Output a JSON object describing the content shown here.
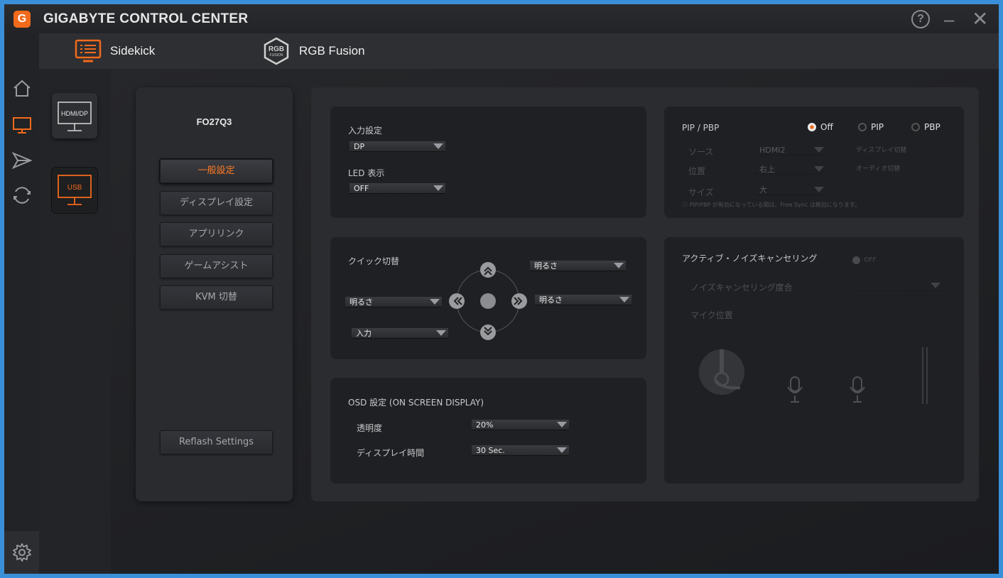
{
  "app": {
    "logo_letter": "G",
    "title": "GIGABYTE CONTROL CENTER"
  },
  "window_controls": {
    "help": "?",
    "minimize": "–",
    "close": "✕"
  },
  "tabs": [
    {
      "label": "Sidekick",
      "icon": "sidekick-icon"
    },
    {
      "label": "RGB Fusion",
      "icon": "rgb-fusion-icon",
      "icon_text_top": "RGB",
      "icon_text_bottom": "FUSION"
    }
  ],
  "devices": [
    {
      "label": "HDMI/DP"
    },
    {
      "label": "USB",
      "selected": true
    }
  ],
  "model": {
    "name": "FO27Q3"
  },
  "menu": [
    {
      "label": "一般設定",
      "active": true
    },
    {
      "label": "ディスプレイ設定"
    },
    {
      "label": "アプリリンク"
    },
    {
      "label": "ゲームアシスト"
    },
    {
      "label": "KVM 切替"
    }
  ],
  "reflash_label": "Reflash Settings",
  "input_card": {
    "input_label": "入力設定",
    "input_value": "DP",
    "led_label": "LED 表示",
    "led_value": "OFF"
  },
  "quick_card": {
    "title": "クイック切替",
    "up": "明るさ",
    "left": "明るさ",
    "right": "明るさ",
    "down": "入力"
  },
  "osd_card": {
    "title": "OSD 設定 (ON SCREEN DISPLAY)",
    "transparency_label": "透明度",
    "transparency_value": "20%",
    "display_time_label": "ディスプレイ時間",
    "display_time_value": "30 Sec."
  },
  "pip_card": {
    "title": "PIP / PBP",
    "options": [
      "Off",
      "PIP",
      "PBP"
    ],
    "selected": "Off",
    "source_label": "ソース",
    "source_value": "HDMI2",
    "position_label": "位置",
    "position_value": "右上",
    "size_label": "サイズ",
    "size_value": "大",
    "btn1": "ディスプレイ切替",
    "btn2": "オーディオ切替",
    "note": "ⓘ PIP/PBP が有効になっている間は、Free Sync は無効になります。"
  },
  "anc_card": {
    "title": "アクティブ・ノイズキャンセリング",
    "toggle": "OFF",
    "level_label": "ノイズキャンセリング度合",
    "mic_label": "マイク位置"
  },
  "colors": {
    "accent": "#f26a1b",
    "bg": "#1c1d20"
  }
}
